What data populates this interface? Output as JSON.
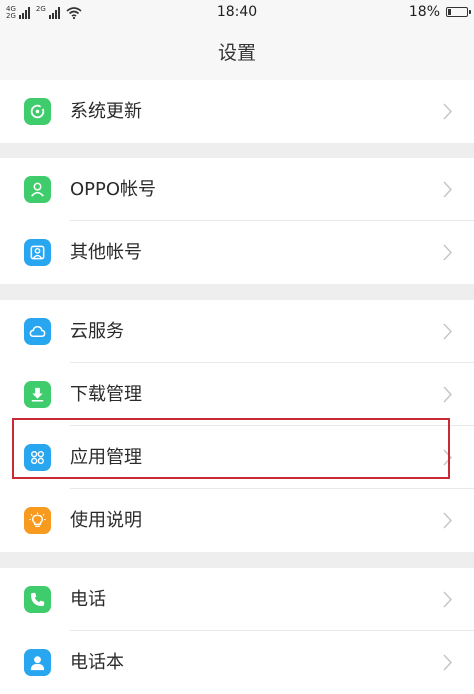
{
  "status_bar": {
    "network_top": "4G",
    "network_bottom": "2G",
    "network_top_2": "2G",
    "time": "18:40",
    "battery": "18%"
  },
  "header": {
    "title": "设置"
  },
  "items": [
    {
      "key": "system-update",
      "label": "系统更新",
      "icon": "refresh-icon",
      "color": "#3fcc6c"
    },
    {
      "key": "oppo-account",
      "label": "OPPO帐号",
      "icon": "person-icon",
      "color": "#3fcc6c"
    },
    {
      "key": "other-accounts",
      "label": "其他帐号",
      "icon": "account-icon",
      "color": "#29a6f0"
    },
    {
      "key": "cloud-service",
      "label": "云服务",
      "icon": "cloud-icon",
      "color": "#29a6f0"
    },
    {
      "key": "download-manager",
      "label": "下载管理",
      "icon": "download-icon",
      "color": "#3fcc6c"
    },
    {
      "key": "app-manager",
      "label": "应用管理",
      "icon": "apps-grid-icon",
      "color": "#29a6f0"
    },
    {
      "key": "user-guide",
      "label": "使用说明",
      "icon": "lightbulb-icon",
      "color": "#f79a1e"
    },
    {
      "key": "phone",
      "label": "电话",
      "icon": "phone-icon",
      "color": "#3fcc6c"
    },
    {
      "key": "contacts",
      "label": "电话本",
      "icon": "contacts-icon",
      "color": "#29a6f0"
    }
  ],
  "highlight_color": "#c92a33"
}
